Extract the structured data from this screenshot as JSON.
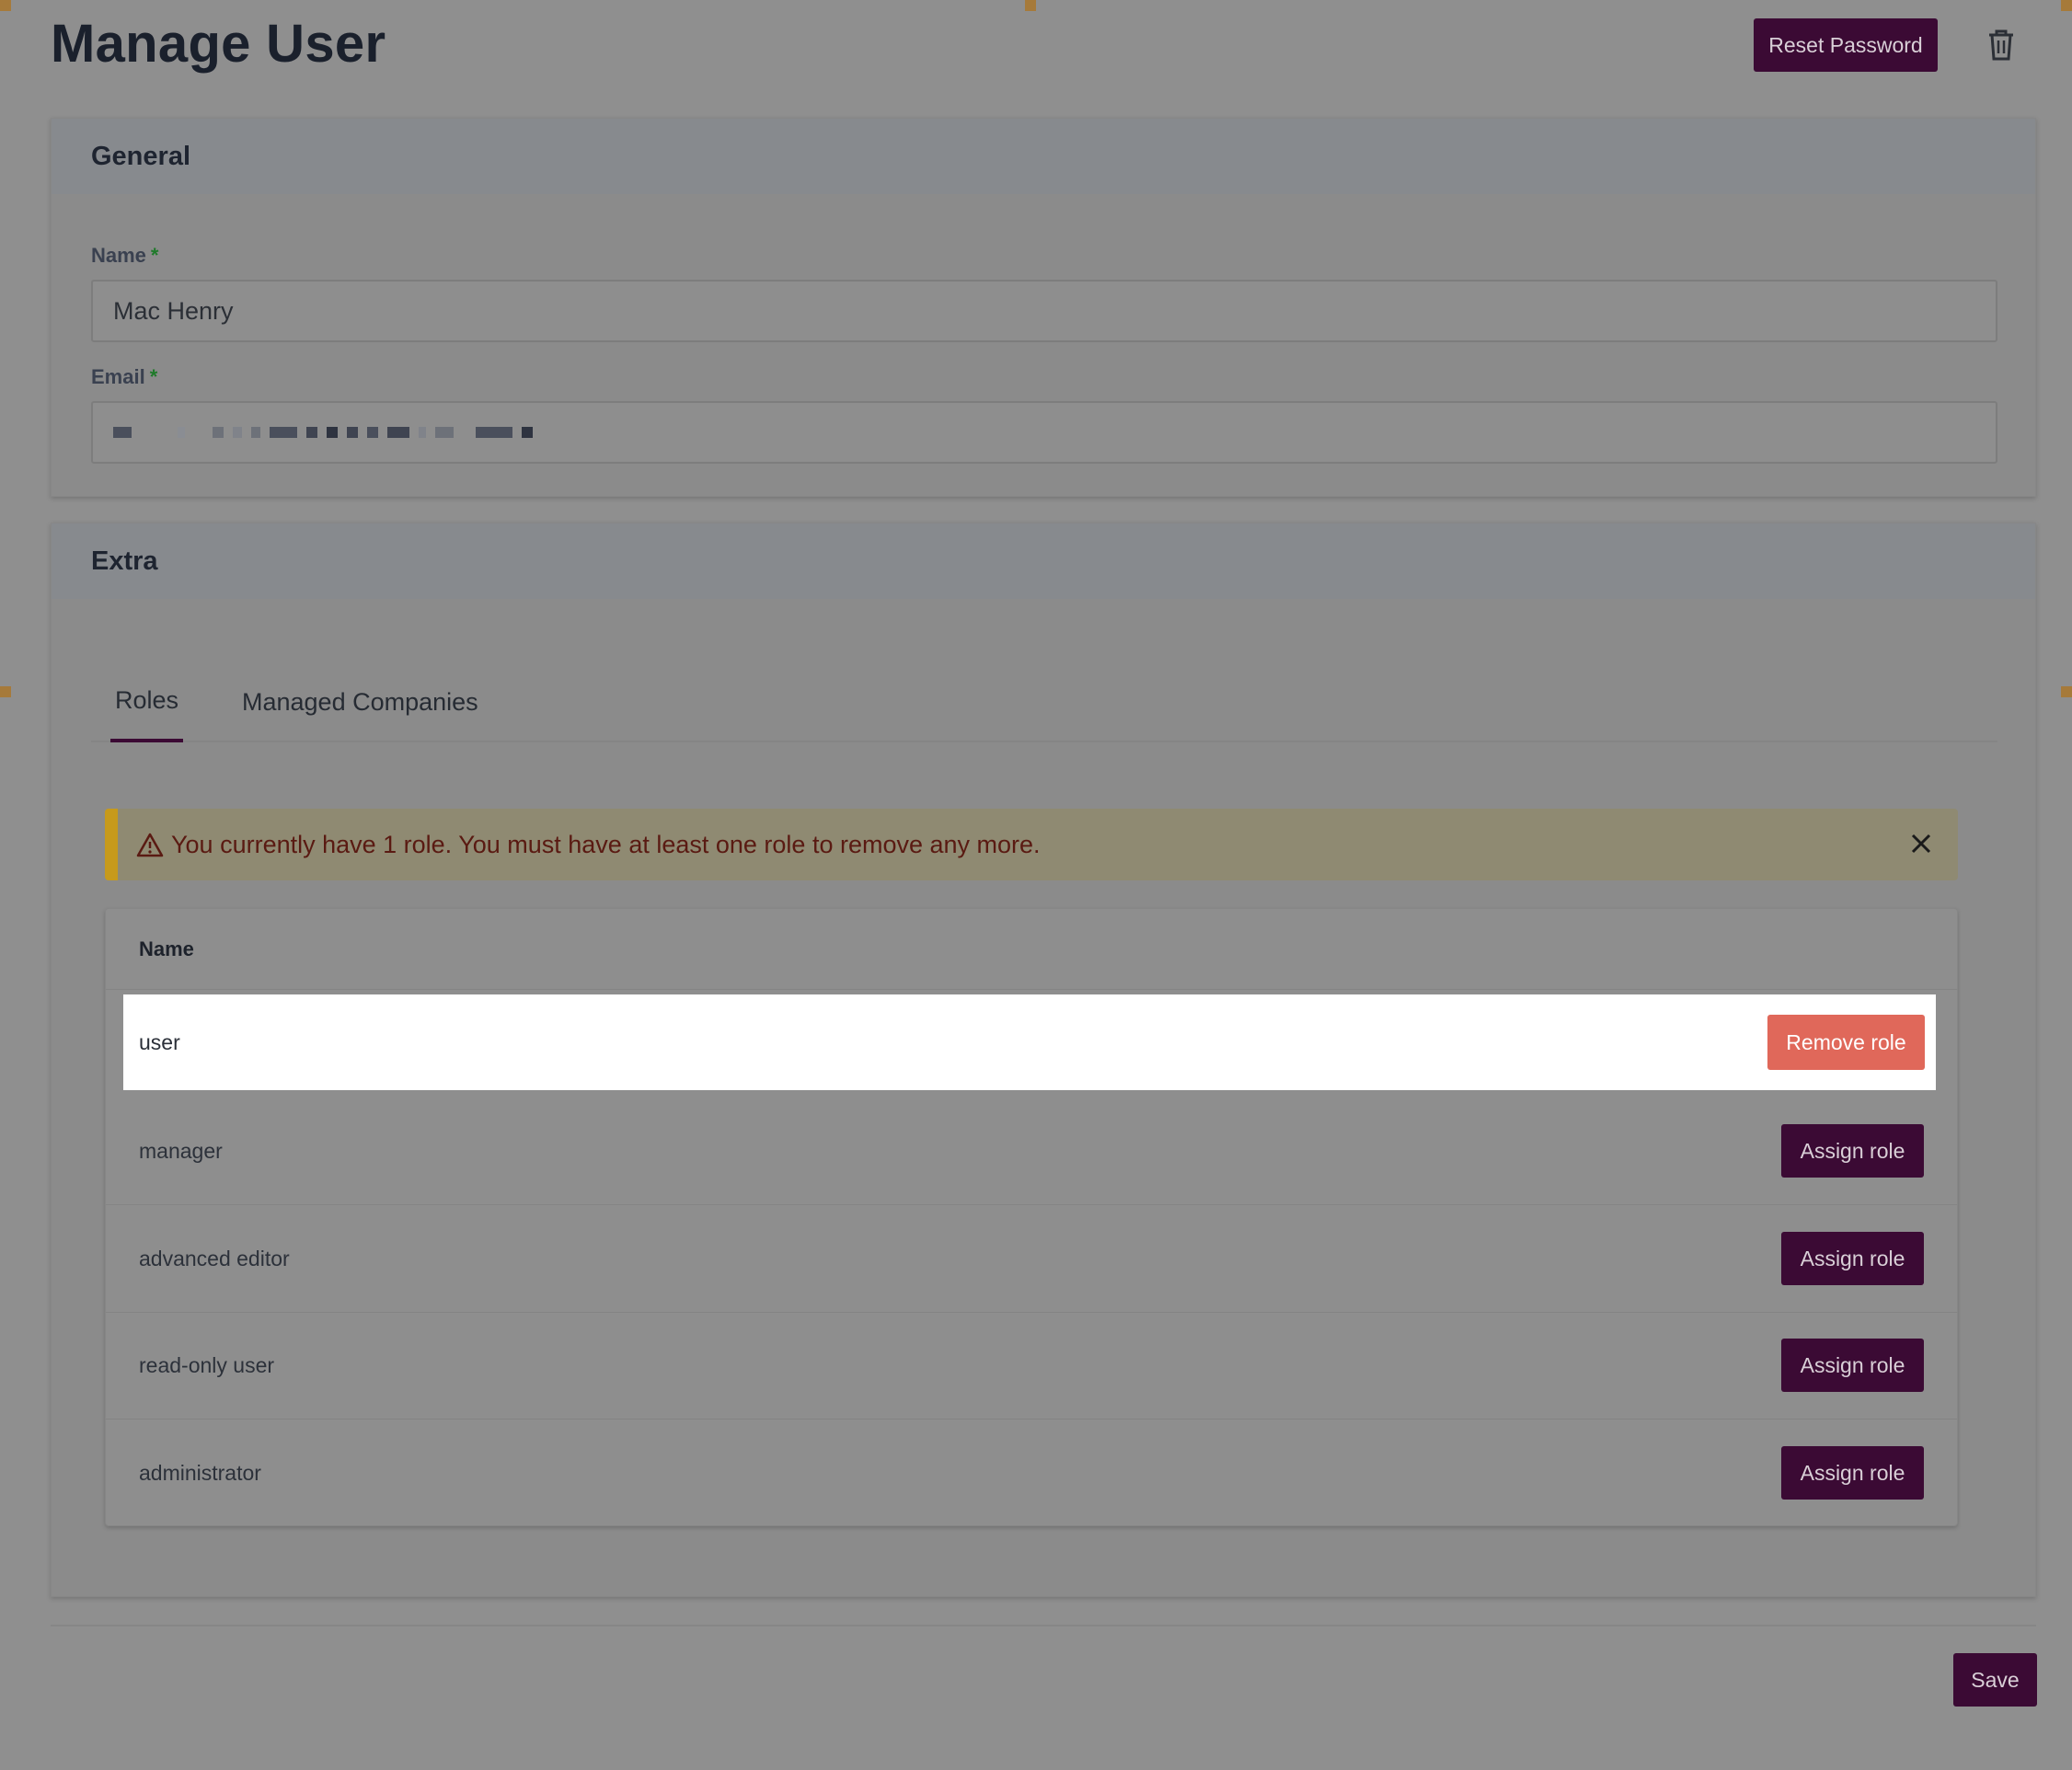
{
  "page": {
    "title": "Manage User",
    "reset_password_label": "Reset Password",
    "delete_icon": "trash-icon"
  },
  "general": {
    "heading": "General",
    "name_label": "Name",
    "name_required": "*",
    "name_value": "Mac Henry",
    "email_label": "Email",
    "email_required": "*"
  },
  "extra": {
    "heading": "Extra",
    "tabs": [
      {
        "label": "Roles",
        "active": true
      },
      {
        "label": "Managed Companies",
        "active": false
      }
    ],
    "alert": {
      "message": "You currently have 1 role. You must have at least one role to remove any more.",
      "icon": "warning-triangle-icon"
    },
    "table": {
      "column_name": "Name",
      "rows": [
        {
          "name": "user",
          "action": "Remove role"
        },
        {
          "name": "manager",
          "action": "Assign role"
        },
        {
          "name": "advanced editor",
          "action": "Assign role"
        },
        {
          "name": "read-only user",
          "action": "Assign role"
        },
        {
          "name": "administrator",
          "action": "Assign role"
        }
      ]
    }
  },
  "footer": {
    "save_label": "Save"
  },
  "colors": {
    "primary": "#3b0a34",
    "danger": "#e0685a",
    "warning_accent": "#c79a1b"
  }
}
